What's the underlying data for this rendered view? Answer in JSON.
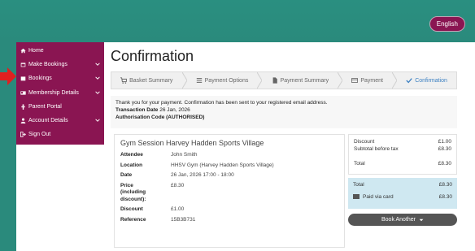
{
  "header": {
    "language_label": "English"
  },
  "sidebar": {
    "items": [
      {
        "label": "Home",
        "icon": "home-icon",
        "chevron": false
      },
      {
        "label": "Make Bookings",
        "icon": "calendar-icon",
        "chevron": true
      },
      {
        "label": "Bookings",
        "icon": "calendar-check-icon",
        "chevron": true
      },
      {
        "label": "Membership Details",
        "icon": "id-card-icon",
        "chevron": true
      },
      {
        "label": "Parent Portal",
        "icon": "child-icon",
        "chevron": false
      },
      {
        "label": "Account Details",
        "icon": "user-icon",
        "chevron": true
      },
      {
        "label": "Sign Out",
        "icon": "sign-out-icon",
        "chevron": false
      }
    ]
  },
  "page": {
    "title": "Confirmation"
  },
  "steps": [
    {
      "label": "Basket Summary",
      "icon": "cart-icon"
    },
    {
      "label": "Payment Options",
      "icon": "list-icon"
    },
    {
      "label": "Payment Summary",
      "icon": "file-icon"
    },
    {
      "label": "Payment",
      "icon": "card-icon"
    },
    {
      "label": "Confirmation",
      "icon": "check-icon"
    }
  ],
  "notice": {
    "message": "Thank you for your payment. Confirmation has been sent to your registered email address.",
    "txn_label": "Transaction Date",
    "txn_value": "26 Jan, 2026",
    "auth_label": "Authorisation Code",
    "auth_value": "(AUTHORISED)"
  },
  "booking": {
    "title": "Gym Session Harvey Hadden Sports Village",
    "rows": [
      {
        "label": "Attendee",
        "value": "John Smith"
      },
      {
        "label": "Location",
        "value": "HHSV Gym (Harvey Hadden Sports Village)"
      },
      {
        "label": "Date",
        "value": "26 Jan, 2026 17:00 - 18:00"
      },
      {
        "label": "Price (including discount):",
        "value": "£8.30"
      },
      {
        "label": "Discount",
        "value": "£1.00"
      },
      {
        "label": "Reference",
        "value": "15B3B731"
      }
    ]
  },
  "summary": {
    "discount_label": "Discount",
    "discount_value": "£1.00",
    "subtotal_label": "Subtotal before tax",
    "subtotal_value": "£8.30",
    "total_label": "Total",
    "total_value": "£8.30",
    "paid_total_label": "Total",
    "paid_total_value": "£8.30",
    "paid_label": "Paid via card",
    "paid_value": "£8.30",
    "book_another_label": "Book Another"
  },
  "colors": {
    "brand": "#8a1552",
    "teal": "#2a8a7c",
    "active_step": "#3a7fc1",
    "paid_bg": "#cfe8f1"
  }
}
